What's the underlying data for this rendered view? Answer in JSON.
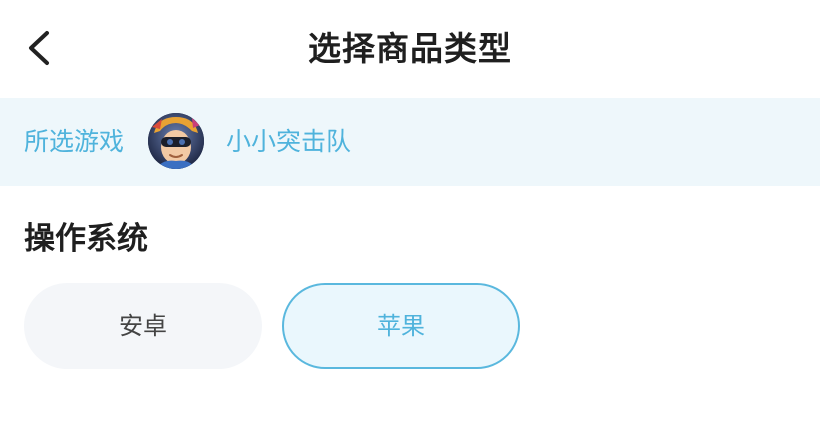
{
  "header": {
    "title": "选择商品类型",
    "back_icon": "chevron-left-icon"
  },
  "game_bar": {
    "label": "所选游戏",
    "game_name": "小小突击队",
    "avatar_icon": "game-avatar"
  },
  "os_section": {
    "title": "操作系统",
    "options": [
      {
        "label": "安卓",
        "selected": false
      },
      {
        "label": "苹果",
        "selected": true
      }
    ]
  },
  "colors": {
    "accent": "#4fb3dc",
    "accent_border": "#5ab8de",
    "bar_bg": "#eef7fb",
    "option_bg": "#f4f6f9",
    "selected_bg": "#eaf7fd",
    "title_text": "#1f1f1f"
  }
}
